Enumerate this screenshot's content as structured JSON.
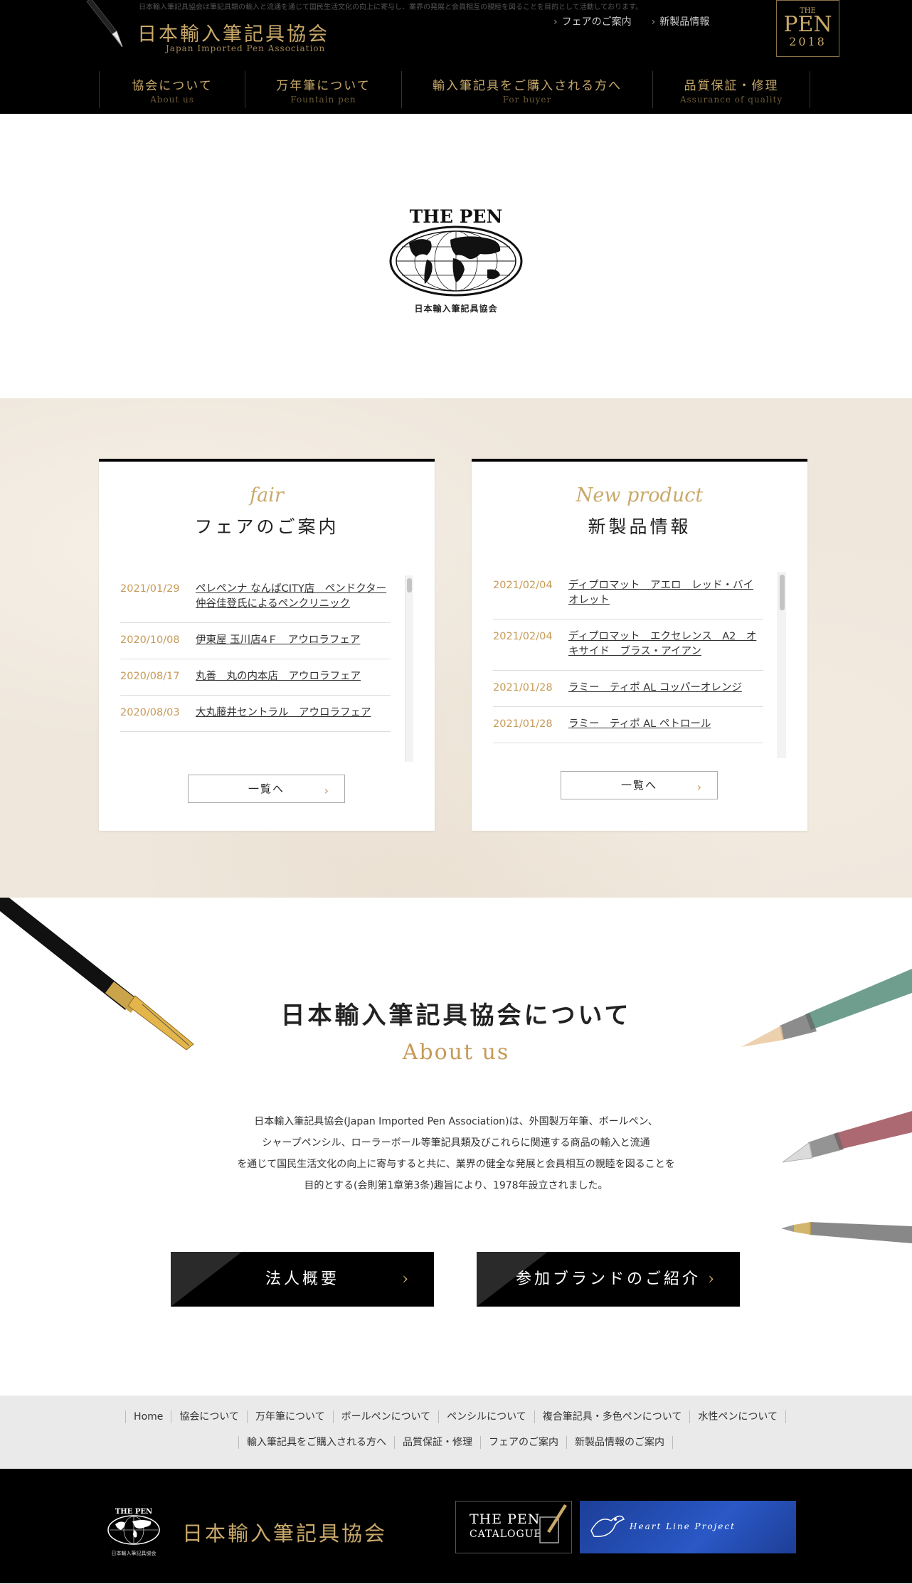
{
  "header": {
    "tagline": "日本輸入筆記具協会は筆記具類の輸入と流通を通じて国民生活文化の向上に寄与し、業界の発展と会員相互の親睦を図ることを目的として活動しております。",
    "logo_title": "日本輸入筆記具協会",
    "logo_subtitle": "Japan Imported Pen Association",
    "top_links": [
      {
        "label": "フェアのご案内"
      },
      {
        "label": "新製品情報"
      }
    ],
    "badge": {
      "line1": "THE",
      "line2": "PEN",
      "line3": "2018"
    },
    "nav": [
      {
        "ja": "協会について",
        "en": "About us"
      },
      {
        "ja": "万年筆について",
        "en": "Fountain pen"
      },
      {
        "ja": "輸入筆記具をご購入される方へ",
        "en": "For buyer"
      },
      {
        "ja": "品質保証・修理",
        "en": "Assurance of quality"
      }
    ]
  },
  "hero": {
    "logo_text": "THE PEN",
    "caption": "日本輸入筆記具協会"
  },
  "fair": {
    "heading_en": "fair",
    "heading_ja": "フェアのご案内",
    "items": [
      {
        "date": "2021/01/29",
        "title": "ペレペンナ なんばCITY店　ペンドクター 仲谷佳登氏によるペンクリニック"
      },
      {
        "date": "2020/10/08",
        "title": "伊東屋 玉川店4Ｆ　アウロラフェア"
      },
      {
        "date": "2020/08/17",
        "title": "丸善　丸の内本店　アウロラフェア"
      },
      {
        "date": "2020/08/03",
        "title": "大丸藤井セントラル　アウロラフェア"
      }
    ],
    "more_label": "一覧へ"
  },
  "newproduct": {
    "heading_en": "New product",
    "heading_ja": "新製品情報",
    "items": [
      {
        "date": "2021/02/04",
        "title": "ディプロマット　アエロ　レッド・バイオレット"
      },
      {
        "date": "2021/02/04",
        "title": "ディプロマット　エクセレンス　A2　オキサイド　ブラス・アイアン"
      },
      {
        "date": "2021/01/28",
        "title": "ラミー　ティポ AL コッパーオレンジ"
      },
      {
        "date": "2021/01/28",
        "title": "ラミー　ティポ AL ペトロール"
      }
    ],
    "more_label": "一覧へ"
  },
  "about": {
    "heading_ja": "日本輸入筆記具協会について",
    "heading_en": "About us",
    "lines": [
      "日本輸入筆記具協会(Japan Imported Pen Association)は、外国製万年筆、ボールペン、",
      "シャープペンシル、ローラーボール等筆記具類及びこれらに関連する商品の輸入と流通",
      "を通じて国民生活文化の向上に寄与すると共に、業界の健全な発展と会員相互の親睦を図ることを",
      "目的とする(会則第1章第3条)趣旨により、1978年設立されました。"
    ],
    "buttons": [
      {
        "label": "法人概要"
      },
      {
        "label": "参加ブランドのご紹介"
      }
    ]
  },
  "footer_links": {
    "row1": [
      "Home",
      "協会について",
      "万年筆について",
      "ボールペンについて",
      "ペンシルについて",
      "複合筆記具・多色ペンについて",
      "水性ペンについて"
    ],
    "row2": [
      "輸入筆記具をご購入される方へ",
      "品質保証・修理",
      "フェアのご案内",
      "新製品情報のご案内"
    ]
  },
  "footer": {
    "logo_text": "THE PEN",
    "logo_caption": "日本輸入筆記具協会",
    "title": "日本輸入筆記具協会",
    "catalogue_line1": "THE PEN",
    "catalogue_line2": "CATALOGUE",
    "heartline": "Heart Line Project"
  },
  "colors": {
    "gold": "#c9a96a",
    "date_gold": "#c69a57",
    "black": "#000000",
    "paper": "#efe7dc",
    "footer_gray": "#eaeaea",
    "heartline_blue": "#2a58c6"
  }
}
